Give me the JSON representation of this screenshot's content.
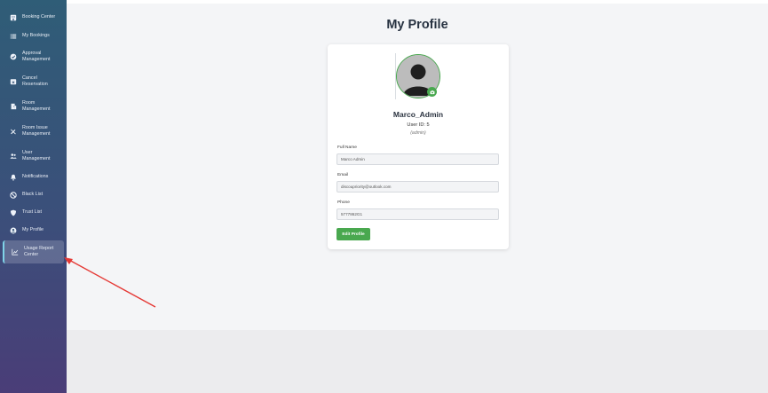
{
  "sidebar": {
    "items": [
      {
        "label": "Booking Center",
        "icon": "building-icon"
      },
      {
        "label": "My Bookings",
        "icon": "list-icon"
      },
      {
        "label": "Approval Management",
        "icon": "check-circle-icon"
      },
      {
        "label": "Cancel Reservation",
        "icon": "calendar-x-icon"
      },
      {
        "label": "Room Management",
        "icon": "door-icon"
      },
      {
        "label": "Room Issue Management",
        "icon": "tools-icon"
      },
      {
        "label": "User Management",
        "icon": "users-icon"
      },
      {
        "label": "Notifications",
        "icon": "bell-icon"
      },
      {
        "label": "Black List",
        "icon": "ban-icon"
      },
      {
        "label": "Trust List",
        "icon": "shield-icon"
      },
      {
        "label": "My Profile",
        "icon": "user-circle-icon"
      },
      {
        "label": "Usage Report Center",
        "icon": "chart-line-icon"
      }
    ],
    "active_index": 11
  },
  "page": {
    "title": "My Profile"
  },
  "profile": {
    "username": "Marco_Admin",
    "user_id": "User ID: 5",
    "role": "(admin)",
    "avatar_icon": "user-avatar-icon",
    "camera_icon": "camera-icon"
  },
  "form": {
    "full_name_label": "Full Name",
    "full_name_value": "Marco Admin",
    "email_label": "Email",
    "email_value": "discoupriority@outlook.com",
    "phone_label": "Phone",
    "phone_value": "5777862G1"
  },
  "actions": {
    "edit_label": "Edit Profile"
  },
  "colors": {
    "accent": "#49a84f",
    "annotation_arrow": "#e53935"
  }
}
